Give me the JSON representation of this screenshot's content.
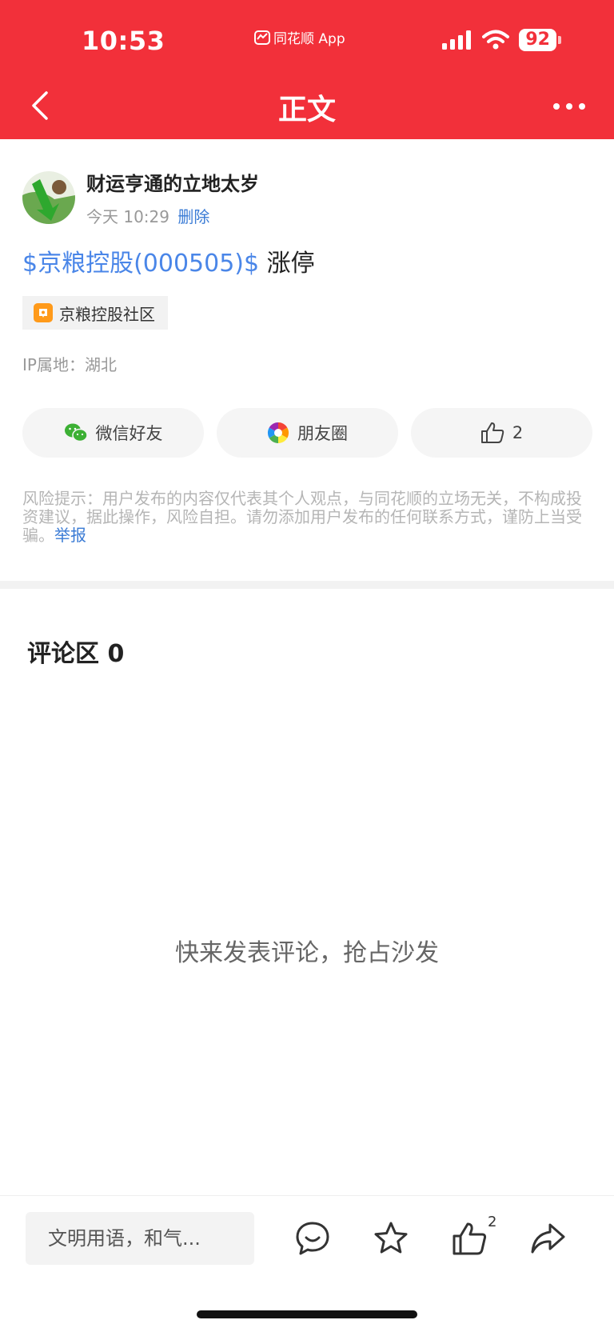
{
  "status_bar": {
    "time": "10:53",
    "app_label": "同花顺 App",
    "battery": "92"
  },
  "nav": {
    "title": "正文"
  },
  "post": {
    "author_name": "财运亨通的立地太岁",
    "time": "今天 10:29",
    "delete_label": "删除",
    "stock_link": "$京粮控股(000505)$",
    "body_text": " 涨停",
    "community_tag": "京粮控股社区",
    "ip_location": "IP属地：湖北"
  },
  "actions": {
    "wechat_label": "微信好友",
    "moments_label": "朋友圈",
    "like_count": "2"
  },
  "disclaimer": {
    "text": "风险提示：用户发布的内容仅代表其个人观点，与同花顺的立场无关，不构成投资建议，据此操作，风险自担。请勿添加用户发布的任何联系方式，谨防上当受骗。",
    "report_label": "举报"
  },
  "comments": {
    "title": "评论区 0",
    "empty_hint": "快来发表评论，抢占沙发"
  },
  "bottom_bar": {
    "input_placeholder": "文明用语，和气...",
    "like_count": "2"
  },
  "colors": {
    "brand_red": "#f2303a",
    "link_blue": "#4a86e8",
    "wechat_green": "#3cb034"
  }
}
